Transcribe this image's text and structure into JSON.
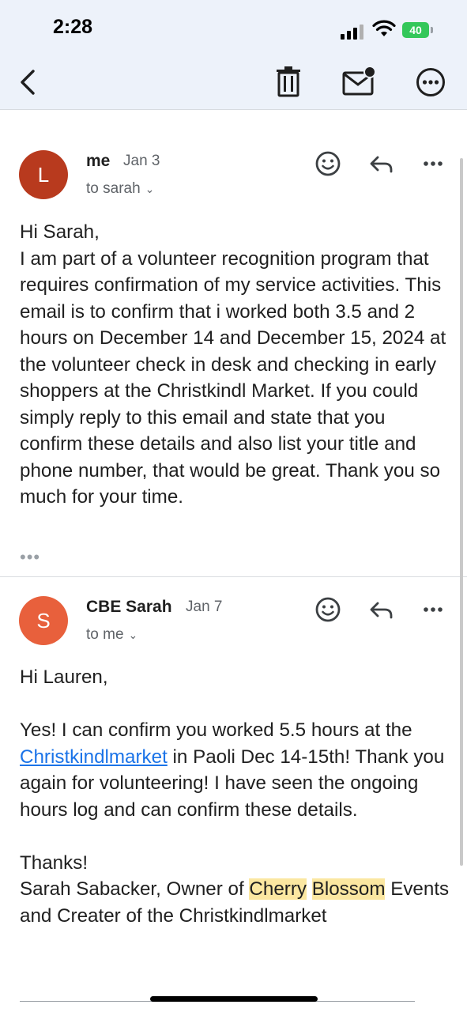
{
  "status_bar": {
    "time": "2:28",
    "battery": "40"
  },
  "toolbar": {
    "back_icon": "chevron-left-icon",
    "delete_icon": "trash-icon",
    "mark_unread_icon": "mail-unread-icon",
    "more_icon": "more-circle-icon"
  },
  "messages": [
    {
      "avatar_letter": "L",
      "avatar_color": "#b83a1e",
      "sender": "me",
      "date": "Jan 3",
      "to": "to sarah",
      "body": [
        "Hi Sarah,",
        "I am part of a volunteer recognition program that requires confirmation of my service activities. This email is to confirm that i worked both 3.5 and 2 hours on December 14 and December 15, 2024 at the volunteer check in desk and checking in early shoppers at the Christkindl Market. If you could simply reply to this email and state that you confirm these details and also list your title and phone number, that would be great. Thank you so much for your time."
      ],
      "collapsed_indicator": "•••"
    },
    {
      "avatar_letter": "S",
      "avatar_color": "#e8603c",
      "sender": "CBE Sarah",
      "date": "Jan 7",
      "to": "to me",
      "greeting": "Hi Lauren,",
      "p1_before": "Yes! I can confirm you worked 5.5 hours at the ",
      "p1_link": "Christkindlmarket",
      "p1_after": " in Paoli Dec 14-15th! Thank you again for volunteering! I have seen the ongoing hours log and can confirm these details.",
      "thanks": "Thanks!",
      "sig_before": "Sarah Sabacker, Owner of ",
      "sig_hl1": "Cherry",
      "sig_hl2": "Blossom",
      "sig_after": "Events and Creater of the Christkindlmarket"
    }
  ],
  "colors": {
    "header_bg": "#edf2fa",
    "link": "#1a73e8",
    "highlight": "#fbe7a1"
  }
}
